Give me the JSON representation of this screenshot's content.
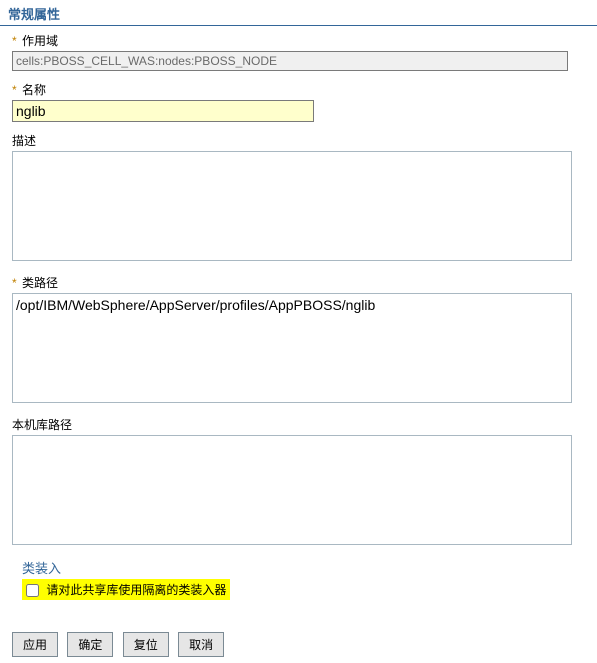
{
  "section_title": "常规属性",
  "fields": {
    "scope": {
      "label": "作用域",
      "required": true,
      "value": "cells:PBOSS_CELL_WAS:nodes:PBOSS_NODE"
    },
    "name": {
      "label": "名称",
      "required": true,
      "value": "nglib"
    },
    "description": {
      "label": "描述",
      "required": false,
      "value": ""
    },
    "classpath": {
      "label": "类路径",
      "required": true,
      "value": "/opt/IBM/WebSphere/AppServer/profiles/AppPBOSS/nglib"
    },
    "nativepath": {
      "label": "本机库路径",
      "required": false,
      "value": ""
    }
  },
  "classloading": {
    "title": "类装入",
    "isolated_label": "请对此共享库使用隔离的类装入器",
    "isolated_checked": false
  },
  "buttons": {
    "apply": "应用",
    "ok": "确定",
    "reset": "复位",
    "cancel": "取消"
  }
}
